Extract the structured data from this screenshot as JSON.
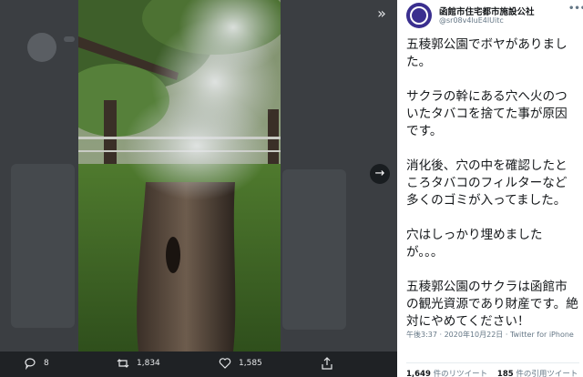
{
  "media": {
    "expand_icon": "»",
    "next_icon": "→"
  },
  "actions": {
    "replies": "8",
    "retweets": "1,834",
    "likes": "1,585"
  },
  "tweet": {
    "display_name": "函館市住宅都市施設公社",
    "handle": "@sr08v4luE4lUitc",
    "more_icon": "•••",
    "paragraphs": [
      "五稜郭公園でボヤがありました。",
      "サクラの幹にある穴へ火のついたタバコを捨てた事が原因です。",
      "消化後、穴の中を確認したところタバコのフィルターなど多くのゴミが入ってました。",
      "穴はしっかり埋めましたが。。。",
      "五稜郭公園のサクラは函館市の観光資源であり財産です。絶対にやめてください！"
    ],
    "timestamp": "午後3:37 · 2020年10月22日 · Twitter for iPhone",
    "retweet_count": "1,649",
    "retweet_label": "件のリツイート",
    "quote_count": "185",
    "quote_label": "件の引用ツイート"
  },
  "colors": {
    "panel_bg": "#ffffff",
    "text_primary": "#14171a",
    "text_secondary": "#657786",
    "overlay_bg": "#3b3e42",
    "action_bar_bg": "#1f2225"
  }
}
